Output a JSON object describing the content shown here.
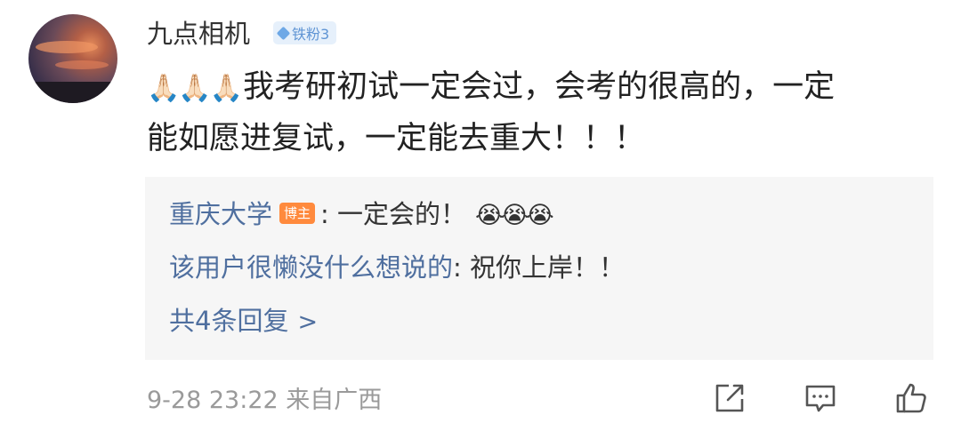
{
  "comment": {
    "author": "九点相机",
    "fan_badge": "铁粉3",
    "emoji_prefix": "🙏🏻🙏🏻🙏🏻",
    "text_line1": "我考研初试一定会过，会考的很高的，一定",
    "text_line2": "能如愿进复试，一定能去重大！！！"
  },
  "replies": [
    {
      "name": "重庆大学",
      "badge": "博主",
      "separator": ": ",
      "text": "一定会的！",
      "emoji": "😭😭😭"
    },
    {
      "name": "该用户很懒没什么想说的",
      "separator": ": ",
      "text": "祝你上岸！！"
    }
  ],
  "more_replies_label": "共4条回复",
  "more_replies_chevron": ">",
  "meta": "9-28 23:22 来自广西",
  "icons": {
    "avatar": "avatar-image",
    "fan_badge": "diamond-icon",
    "share": "share-icon",
    "comment": "comment-icon",
    "like": "thumbs-up-icon"
  },
  "colors": {
    "link_blue": "#4f6f9f",
    "blogger_badge": "#ff8a3d",
    "fan_badge_bg": "#e6f0fb",
    "meta_gray": "#9a9a9a",
    "reply_bg": "#f6f6f6"
  }
}
